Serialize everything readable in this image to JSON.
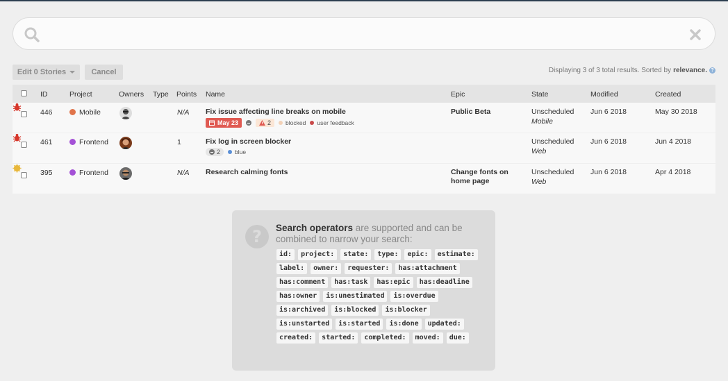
{
  "search": {
    "placeholder": "",
    "value": ""
  },
  "toolbar": {
    "edit_label": "Edit 0 Stories",
    "cancel_label": "Cancel",
    "results_prefix": "Displaying 3 of 3 total results. Sorted by",
    "results_sort": "relevance."
  },
  "table": {
    "headers": {
      "id": "ID",
      "project": "Project",
      "owners": "Owners",
      "type": "Type",
      "points": "Points",
      "name": "Name",
      "epic": "Epic",
      "state": "State",
      "modified": "Modified",
      "created": "Created"
    },
    "rows": [
      {
        "id": "446",
        "project": "Mobile",
        "project_color": "#e0744a",
        "type_icon": "bug-icon",
        "points": "N/A",
        "name": "Fix issue affecting line breaks on mobile",
        "deadline": "May 23",
        "blockers": "2",
        "labels": [
          "blocked",
          "user feedback"
        ],
        "epic": "Public Beta",
        "state": "Unscheduled",
        "state_sub": "Mobile",
        "modified": "Jun 6 2018",
        "created": "May 30 2018"
      },
      {
        "id": "461",
        "project": "Frontend",
        "project_color": "#a451d6",
        "type_icon": "bug-icon",
        "points": "1",
        "name": "Fix log in screen blocker",
        "comments": "2",
        "labels": [
          "blue"
        ],
        "epic": "",
        "state": "Unscheduled",
        "state_sub": "Web",
        "modified": "Jun 6 2018",
        "created": "Jun 4 2018"
      },
      {
        "id": "395",
        "project": "Frontend",
        "project_color": "#a451d6",
        "type_icon": "feature-icon",
        "points": "N/A",
        "name": "Research calming fonts",
        "epic_line1": "Change fonts on",
        "epic_line2": "home page",
        "state": "Unscheduled",
        "state_sub": "Web",
        "modified": "Jun 6 2018",
        "created": "Apr 4 2018"
      }
    ]
  },
  "operators": {
    "heading_bold": "Search operators",
    "heading_rest": " are supported and can be combined to narrow your search:",
    "items": [
      "id:",
      "project:",
      "state:",
      "type:",
      "epic:",
      "estimate:",
      "label:",
      "owner:",
      "requester:",
      "has:attachment",
      "has:comment",
      "has:task",
      "has:epic",
      "has:deadline",
      "has:owner",
      "is:unestimated",
      "is:overdue",
      "is:archived",
      "is:blocked",
      "is:blocker",
      "is:unstarted",
      "is:started",
      "is:done",
      "updated:",
      "created:",
      "started:",
      "completed:",
      "moved:",
      "due:"
    ]
  },
  "colors": {
    "link": "#1d5fa8",
    "deadline": "#e05a52",
    "bug": "#d6372b",
    "feature": "#e8b73a"
  }
}
